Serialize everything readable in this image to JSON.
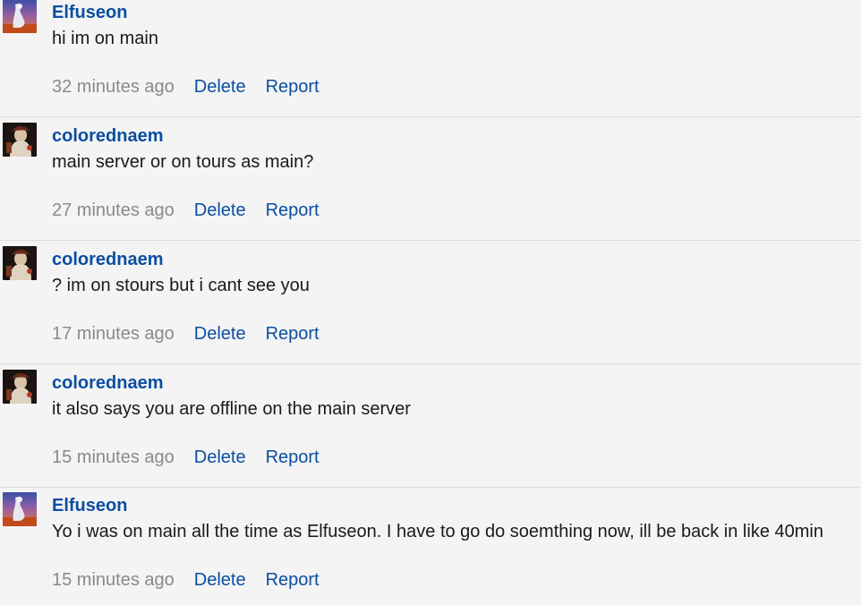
{
  "comments": [
    {
      "author": "Elfuseon",
      "avatar": "elfuseon-avatar-icon",
      "text": "hi im on main",
      "time": "32 minutes ago",
      "delete_label": "Delete",
      "report_label": "Report"
    },
    {
      "author": "colorednaem",
      "avatar": "colorednaem-avatar-icon",
      "text": "main server or on tours as main?",
      "time": "27 minutes ago",
      "delete_label": "Delete",
      "report_label": "Report"
    },
    {
      "author": "colorednaem",
      "avatar": "colorednaem-avatar-icon",
      "text": "? im on stours but i cant see you",
      "time": "17 minutes ago",
      "delete_label": "Delete",
      "report_label": "Report"
    },
    {
      "author": "colorednaem",
      "avatar": "colorednaem-avatar-icon",
      "text": "it also says you are offline on the main server",
      "time": "15 minutes ago",
      "delete_label": "Delete",
      "report_label": "Report"
    },
    {
      "author": "Elfuseon",
      "avatar": "elfuseon-avatar-icon",
      "text": "Yo i was on main all the time as Elfuseon. I have to go do soemthing now, ill be back in like 40min",
      "time": "15 minutes ago",
      "delete_label": "Delete",
      "report_label": "Report"
    }
  ],
  "colors": {
    "author": "#0b4ea2",
    "link": "#0b4ea2",
    "timestamp": "#8a8a8a",
    "text": "#1a1a1a",
    "background": "#f4f4f4"
  }
}
